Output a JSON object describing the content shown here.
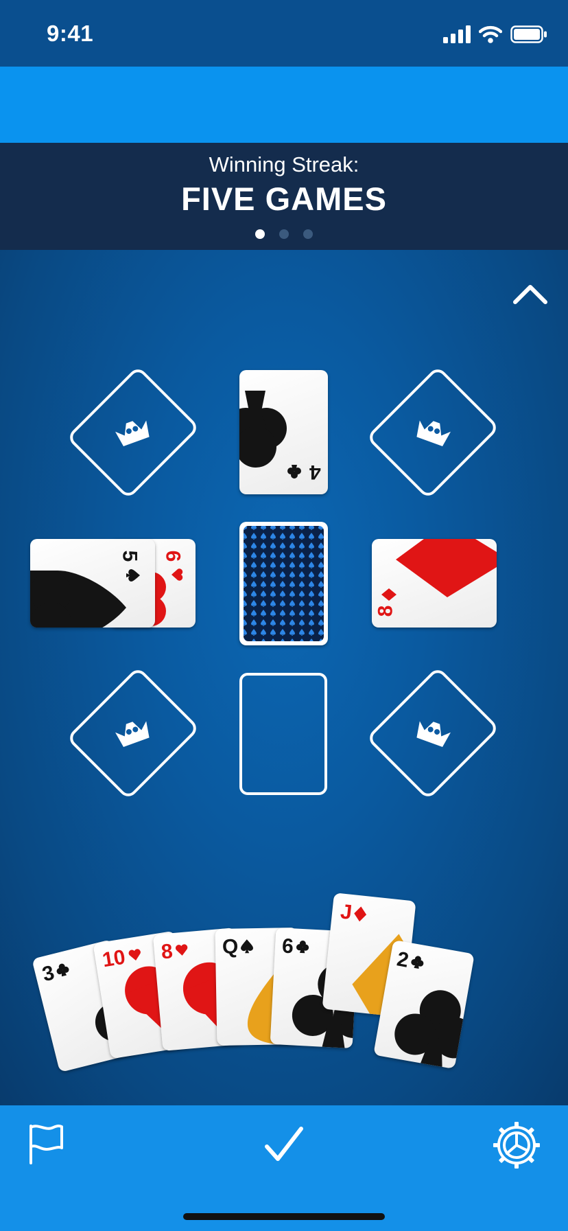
{
  "status": {
    "time": "9:41"
  },
  "banner": {
    "subtitle": "Winning Streak:",
    "title": "FIVE GAMES",
    "page_dots": {
      "count": 3,
      "active": 1
    }
  },
  "board": {
    "top_card": {
      "rank": "4",
      "suit": "clubs"
    },
    "left_cards": [
      {
        "rank": "6",
        "suit": "hearts"
      },
      {
        "rank": "5",
        "suit": "spades"
      }
    ],
    "right_card": {
      "rank": "8",
      "suit": "diamonds"
    },
    "stock_pile": "face-down",
    "empty_slot": "empty",
    "crown_slots": [
      "crown-icon",
      "crown-icon",
      "crown-icon",
      "crown-icon"
    ]
  },
  "hand": {
    "cards": [
      {
        "rank": "3",
        "suit": "clubs"
      },
      {
        "rank": "10",
        "suit": "hearts"
      },
      {
        "rank": "8",
        "suit": "hearts"
      },
      {
        "rank": "Q",
        "suit": "spades"
      },
      {
        "rank": "6",
        "suit": "clubs"
      },
      {
        "rank": "J",
        "suit": "diamonds"
      },
      {
        "rank": "2",
        "suit": "clubs"
      }
    ]
  },
  "toolbar": {
    "icons": [
      "flag-icon",
      "checkmark-icon",
      "settings-gear-icon"
    ]
  },
  "colors": {
    "table": "#0a5aa0",
    "ad_bar": "#0a93ef",
    "banner": "#142c4d",
    "toolbar": "#1490e8",
    "red_suit": "#e01515",
    "black_suit": "#141414",
    "face_accent": "#e8a11c"
  }
}
